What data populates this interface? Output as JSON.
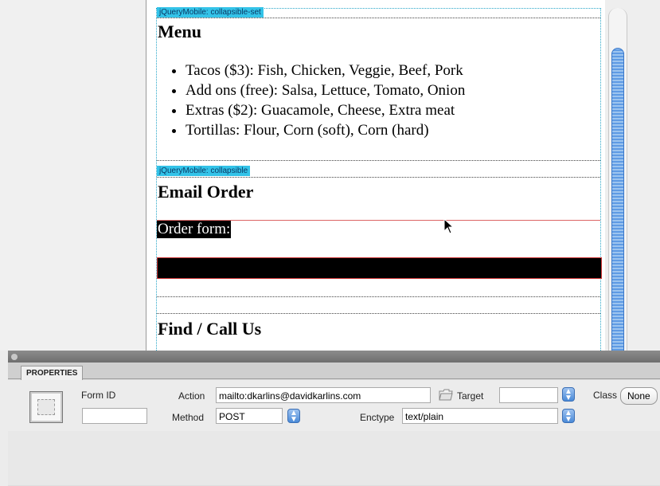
{
  "canvas": {
    "collapsible_set_tag": "jQueryMobile: collapsible-set",
    "collapsible_tag": "jQueryMobile: collapsible",
    "menu_heading": "Menu",
    "menu_items": [
      "Tacos ($3): Fish, Chicken, Veggie, Beef, Pork",
      "Add ons (free): Salsa, Lettuce, Tomato, Onion",
      "Extras ($2): Guacamole, Cheese, Extra meat",
      "Tortillas: Flour, Corn (soft), Corn (hard)"
    ],
    "email_heading": "Email Order",
    "order_form_label": "Order form:",
    "find_heading": "Find / Call Us"
  },
  "properties": {
    "tab_label": "PROPERTIES",
    "form_id_label": "Form ID",
    "form_id_value": "",
    "action_label": "Action",
    "action_value": "mailto:dkarlins@davidkarlins.com",
    "target_label": "Target",
    "target_value": "",
    "class_label": "Class",
    "class_value": "None",
    "method_label": "Method",
    "method_value": "POST",
    "enctype_label": "Enctype",
    "enctype_value": "text/plain"
  },
  "icons": {
    "folder": "folder-icon",
    "stepper": "up-down-arrows-icon",
    "cursor": "mouse-pointer-icon",
    "form": "form-icon"
  },
  "colors": {
    "tag_background": "#33c3e8",
    "selection": "#000000",
    "scroll_thumb": "#5f9be4"
  }
}
